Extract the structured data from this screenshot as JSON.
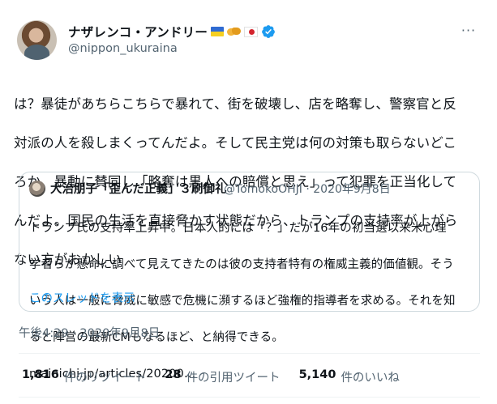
{
  "author": {
    "display_name": "ナザレンコ・アンドリー",
    "handle": "@nippon_ukuraina",
    "icons": [
      "ukraine-flag-icon",
      "handshake-icon",
      "japan-flag-icon",
      "verified-badge-icon"
    ]
  },
  "tweet": {
    "text_lines": [
      "は？暴徒があちらこちらで暴れて、街を破壊し、店を略奪し、警察官と反",
      "対派の人を殺しまくってんだよ。そして民主党は何の対策も取らないどこ",
      "ろか、暴動に賛同し「略奪は黒人への賠償と思え」って犯罪を正当化して",
      "んだよ。国民の生活を直接脅かす状態だから、トランプの支持率が上がら",
      "ない方がおかしい"
    ],
    "timestamp": "午後4:29 · 2020年9月8日"
  },
  "quoted_tweet": {
    "display_name": "大治朋子「歪んだ正義」３刷御礼",
    "meta": "@TomokoOHJI · 2020年9月8日",
    "text_lines": [
      "トランプ氏の支持率上昇中。日本人的には「？」だが16年の初当選以来米心理",
      "学者らが懸命に調べて見えてきたのは彼の支持者特有の権威主義的価値観。そう",
      "いう人は一般に脅威に敏感で危機に瀕するほど強権的指導者を求める。それを知",
      "ると陣営の最新CMもなるほど、と納得できる。",
      "mainichi.jp/articles/20200…"
    ],
    "thread_link": "このスレッドを表示"
  },
  "stats": {
    "retweets_count": "1,816",
    "retweets_label": "件のリツイート",
    "quotes_count": "28",
    "quotes_label": "件の引用ツイート",
    "likes_count": "5,140",
    "likes_label": "件のいいね"
  },
  "menu": {
    "more_label": "···"
  },
  "colors": {
    "text_primary": "#0f1419",
    "text_secondary": "#536471",
    "link": "#1d9bf0",
    "border": "#cfd9de",
    "verified": "#1d9bf0"
  }
}
